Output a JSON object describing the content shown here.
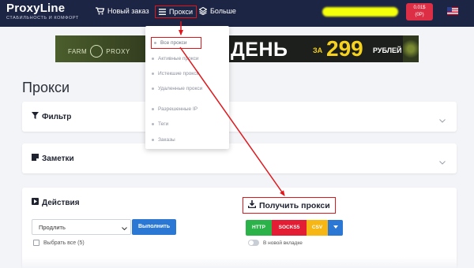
{
  "navbar": {
    "logo_name": "ProxyLine",
    "logo_tagline": "СТАБИЛЬНОСТЬ И КОМФОРТ",
    "new_order": "Новый заказ",
    "proxy": "Прокси",
    "more": "Больше",
    "balance_line1": "0.01$",
    "balance_line2": "(0P)"
  },
  "banner": {
    "farm": "FARM",
    "proxy": "PROXY",
    "day": "ДЕНЬ",
    "za": "ЗА",
    "price": "299",
    "currency": "РУБЛЕЙ"
  },
  "page": {
    "title": "Прокси"
  },
  "filter_card": {
    "title": "Фильтр"
  },
  "notes_card": {
    "title": "Заметки"
  },
  "actions_card": {
    "title": "Действия",
    "select_value": "Продлить",
    "run_button": "Выполнить",
    "select_all": "Выбрать все (5)",
    "get_proxies": "Получить прокси",
    "formats": [
      "HTTP",
      "SOCKS5",
      "CSV"
    ],
    "new_tab": "В новой вкладке"
  },
  "dropdown": {
    "items": [
      "Все прокси",
      "Активные прокси",
      "Истекшие прокси",
      "Удаленные прокси",
      "Разрешенные IP",
      "Теги",
      "Заказы"
    ]
  },
  "colors": {
    "navbar": "#1d2545",
    "annotation_red": "#e0161b",
    "http": "#2bb34a",
    "socks5": "#e21d34",
    "csv": "#f6b613",
    "primary": "#2a77d4"
  }
}
